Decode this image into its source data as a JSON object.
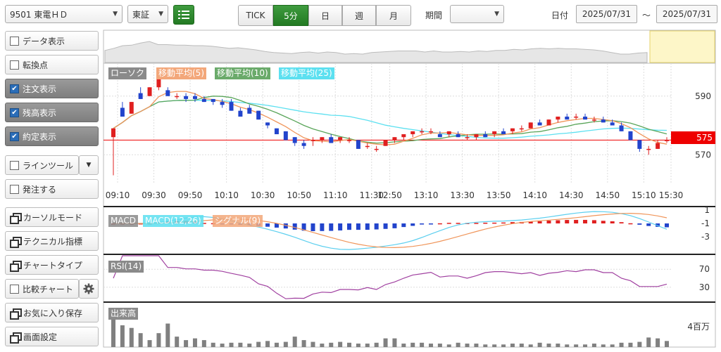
{
  "toolbar": {
    "stock": "9501 東電ＨＤ",
    "market": "東証",
    "intervals": [
      "TICK",
      "5分",
      "日",
      "週",
      "月"
    ],
    "active_interval": "5分",
    "period_label": "期間",
    "period_value": "",
    "date_label": "日付",
    "date_from": "2025/07/31",
    "tilde": "～",
    "date_to": "2025/07/31"
  },
  "menu": {
    "data_display": "データ表示",
    "turning_point": "転換点",
    "order_display": "注文表示",
    "position_display": "残高表示",
    "execution_display": "約定表示",
    "line_tool": "ラインツール",
    "place_order": "発注する",
    "cursor_mode": "カーソルモード",
    "technical": "テクニカル指標",
    "chart_type": "チャートタイプ",
    "compare_chart": "比較チャート",
    "save_favorite": "お気に入り保存",
    "screen_settings": "画面設定"
  },
  "legend": {
    "candle": "ローソク",
    "ma5": "移動平均(5)",
    "ma10": "移動平均(10)",
    "ma25": "移動平均(25)",
    "macd": "MACD",
    "macd_line": "MACD(12,26)",
    "signal": "シグナル(9)",
    "rsi": "RSI(14)",
    "volume": "出来高"
  },
  "colors": {
    "up": "#e02020",
    "down": "#2244cc",
    "ma5": "#f0955a",
    "ma10": "#5aa55a",
    "ma25": "#5ce0f0",
    "rsi": "#a040a0",
    "volume": "#808080",
    "current_price": "#ee0000",
    "accent": "#2a8a2a"
  },
  "chart_data": {
    "type": "candlestick",
    "current_price": 575,
    "price_ticks": [
      "590",
      "570"
    ],
    "time_labels": [
      "09:10",
      "09:30",
      "09:50",
      "10:10",
      "10:30",
      "10:50",
      "11:10",
      "11:30",
      "12:50",
      "13:10",
      "13:30",
      "13:50",
      "14:10",
      "14:30",
      "14:50",
      "15:10",
      "15:30"
    ],
    "macd_ticks": [
      "1",
      "-1",
      "-3"
    ],
    "rsi_ticks": [
      "70",
      "30"
    ],
    "volume_tick": "4百万",
    "candles": [
      {
        "o": 576,
        "h": 579,
        "l": 563,
        "c": 579
      },
      {
        "o": 586,
        "h": 588,
        "l": 583,
        "c": 583
      },
      {
        "o": 584,
        "h": 588,
        "l": 584,
        "c": 588
      },
      {
        "o": 591,
        "h": 593,
        "l": 589,
        "c": 589
      },
      {
        "o": 590,
        "h": 593,
        "l": 590,
        "c": 593
      },
      {
        "o": 593,
        "h": 597,
        "l": 592,
        "c": 596
      },
      {
        "o": 592,
        "h": 593,
        "l": 590,
        "c": 590
      },
      {
        "o": 590,
        "h": 591,
        "l": 589,
        "c": 590
      },
      {
        "o": 590,
        "h": 591,
        "l": 588,
        "c": 589
      },
      {
        "o": 590,
        "h": 591,
        "l": 588,
        "c": 589
      },
      {
        "o": 589,
        "h": 590,
        "l": 588,
        "c": 588
      },
      {
        "o": 589,
        "h": 589,
        "l": 587,
        "c": 588
      },
      {
        "o": 588,
        "h": 589,
        "l": 586,
        "c": 587
      },
      {
        "o": 588,
        "h": 589,
        "l": 585,
        "c": 585
      },
      {
        "o": 585,
        "h": 586,
        "l": 583,
        "c": 583
      },
      {
        "o": 586,
        "h": 587,
        "l": 584,
        "c": 584
      },
      {
        "o": 585,
        "h": 585,
        "l": 582,
        "c": 582
      },
      {
        "o": 581,
        "h": 581,
        "l": 579,
        "c": 580
      },
      {
        "o": 579,
        "h": 579,
        "l": 577,
        "c": 577
      },
      {
        "o": 578,
        "h": 578,
        "l": 575,
        "c": 575
      },
      {
        "o": 576,
        "h": 576,
        "l": 573,
        "c": 574
      },
      {
        "o": 574,
        "h": 575,
        "l": 572,
        "c": 573
      },
      {
        "o": 575,
        "h": 576,
        "l": 573,
        "c": 575
      },
      {
        "o": 575,
        "h": 576,
        "l": 574,
        "c": 576
      },
      {
        "o": 576,
        "h": 577,
        "l": 574,
        "c": 574
      },
      {
        "o": 575,
        "h": 576,
        "l": 574,
        "c": 576
      },
      {
        "o": 575,
        "h": 576,
        "l": 574,
        "c": 575
      },
      {
        "o": 575,
        "h": 575,
        "l": 572,
        "c": 572
      },
      {
        "o": 573,
        "h": 574,
        "l": 572,
        "c": 573
      },
      {
        "o": 572,
        "h": 573,
        "l": 571,
        "c": 572
      },
      {
        "o": 573,
        "h": 575,
        "l": 573,
        "c": 575
      },
      {
        "o": 575,
        "h": 576,
        "l": 574,
        "c": 576
      },
      {
        "o": 576,
        "h": 577,
        "l": 575,
        "c": 577
      },
      {
        "o": 577,
        "h": 578,
        "l": 576,
        "c": 578
      },
      {
        "o": 578,
        "h": 579,
        "l": 577,
        "c": 578
      },
      {
        "o": 578,
        "h": 579,
        "l": 577,
        "c": 578
      },
      {
        "o": 577,
        "h": 578,
        "l": 576,
        "c": 576
      },
      {
        "o": 577,
        "h": 578,
        "l": 576,
        "c": 578
      },
      {
        "o": 577,
        "h": 578,
        "l": 576,
        "c": 576
      },
      {
        "o": 576,
        "h": 577,
        "l": 575,
        "c": 576
      },
      {
        "o": 576,
        "h": 577,
        "l": 575,
        "c": 577
      },
      {
        "o": 577,
        "h": 578,
        "l": 576,
        "c": 576
      },
      {
        "o": 577,
        "h": 578,
        "l": 576,
        "c": 578
      },
      {
        "o": 578,
        "h": 579,
        "l": 577,
        "c": 577
      },
      {
        "o": 578,
        "h": 579,
        "l": 577,
        "c": 579
      },
      {
        "o": 579,
        "h": 580,
        "l": 578,
        "c": 579
      },
      {
        "o": 579,
        "h": 581,
        "l": 579,
        "c": 581
      },
      {
        "o": 581,
        "h": 582,
        "l": 580,
        "c": 580
      },
      {
        "o": 580,
        "h": 582,
        "l": 580,
        "c": 582
      },
      {
        "o": 582,
        "h": 583,
        "l": 581,
        "c": 583
      },
      {
        "o": 583,
        "h": 584,
        "l": 582,
        "c": 582
      },
      {
        "o": 583,
        "h": 584,
        "l": 582,
        "c": 583
      },
      {
        "o": 583,
        "h": 584,
        "l": 582,
        "c": 582
      },
      {
        "o": 582,
        "h": 583,
        "l": 581,
        "c": 582
      },
      {
        "o": 582,
        "h": 583,
        "l": 581,
        "c": 581
      },
      {
        "o": 581,
        "h": 582,
        "l": 580,
        "c": 580
      },
      {
        "o": 580,
        "h": 581,
        "l": 578,
        "c": 578
      },
      {
        "o": 578,
        "h": 578,
        "l": 575,
        "c": 575
      },
      {
        "o": 575,
        "h": 575,
        "l": 571,
        "c": 572
      },
      {
        "o": 572,
        "h": 573,
        "l": 570,
        "c": 572
      },
      {
        "o": 572,
        "h": 575,
        "l": 572,
        "c": 574
      },
      {
        "o": 575,
        "h": 576,
        "l": 574,
        "c": 575
      }
    ],
    "volume": [
      4.2,
      2.5,
      2.2,
      1.6,
      0.8,
      1.6,
      2.7,
      1.2,
      0.8,
      1.0,
      0.8,
      0.5,
      0.4,
      0.5,
      0.5,
      0.4,
      0.6,
      0.7,
      0.5,
      0.6,
      1.2,
      0.8,
      0.6,
      0.4,
      0.5,
      0.6,
      0.5,
      0.4,
      0.4,
      0.5,
      1.0,
      1.0,
      0.4,
      0.5,
      0.5,
      0.4,
      0.4,
      0.3,
      0.5,
      0.4,
      0.4,
      0.3,
      0.3,
      0.3,
      0.4,
      0.4,
      0.3,
      0.5,
      0.4,
      0.4,
      0.3,
      0.3,
      0.3,
      0.4,
      0.3,
      0.3,
      0.5,
      0.5,
      0.6,
      1.1,
      1.0,
      0.7
    ]
  }
}
